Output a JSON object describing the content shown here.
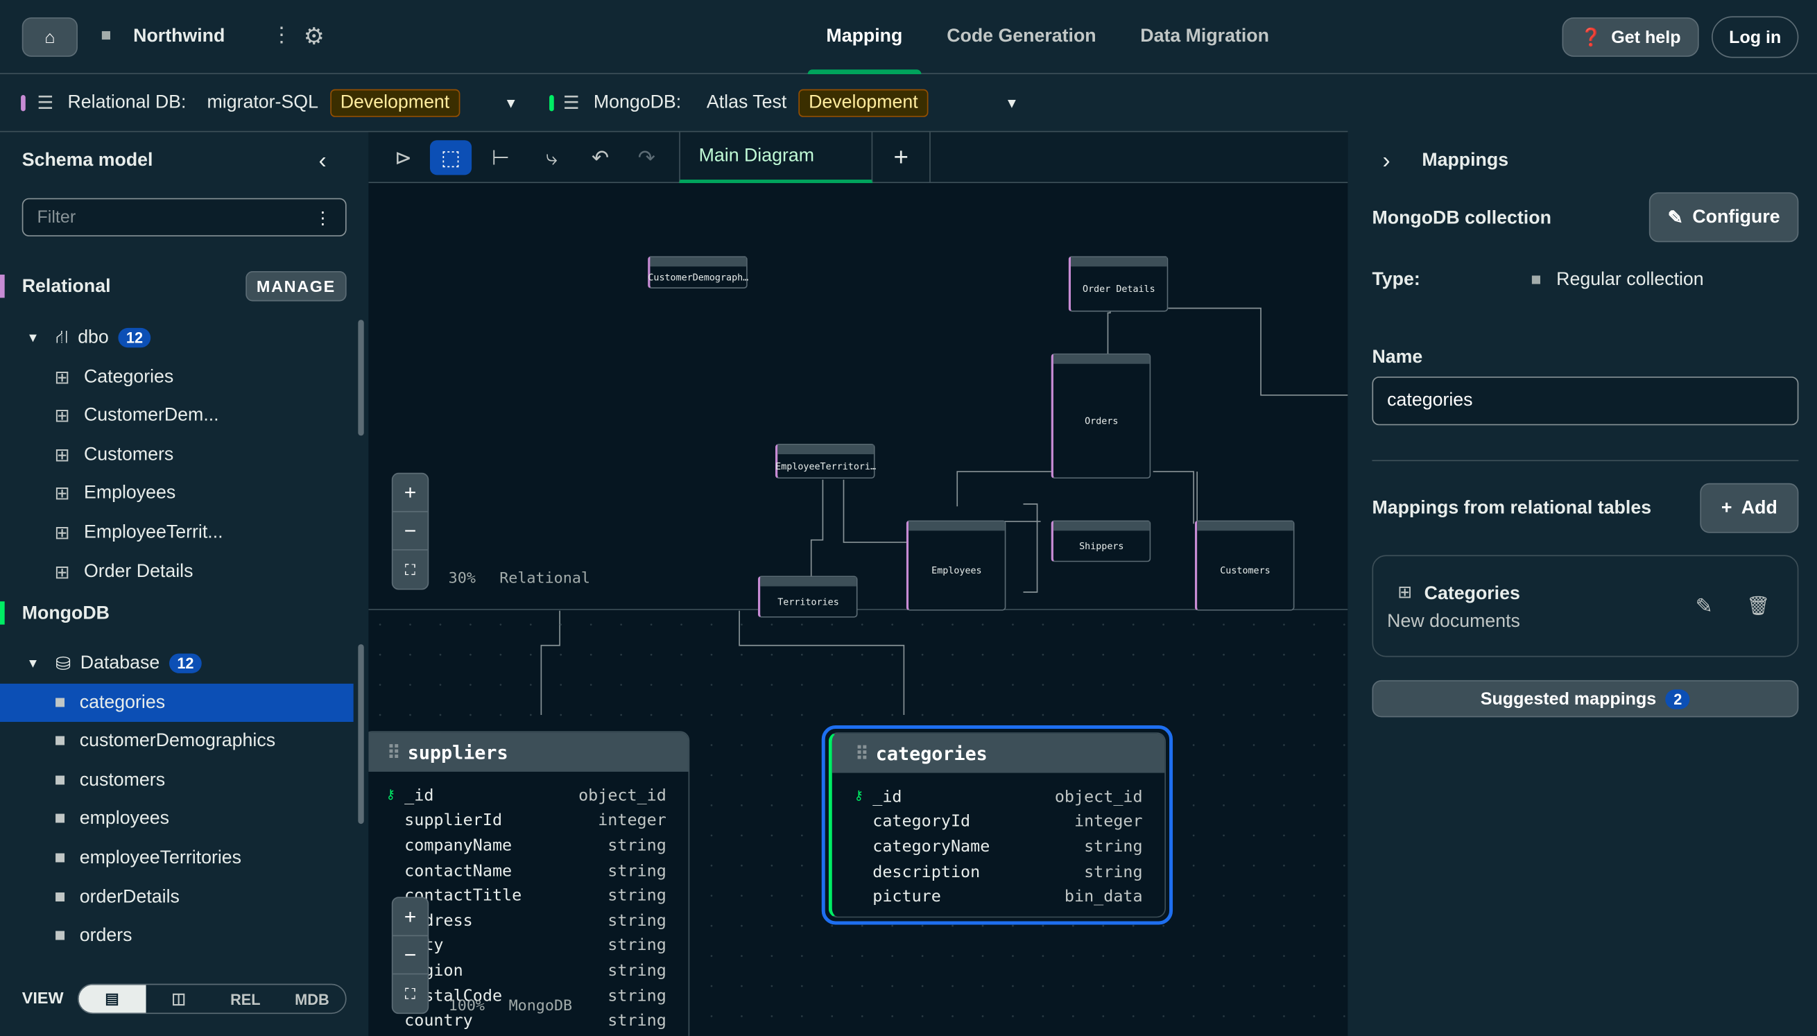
{
  "topbar": {
    "project": "Northwind",
    "tabs": [
      "Mapping",
      "Code Generation",
      "Data Migration"
    ],
    "help": "Get help",
    "login": "Log in"
  },
  "connections": {
    "relational_label": "Relational DB:",
    "relational_name": "migrator-SQL",
    "relational_env": "Development",
    "mongo_label": "MongoDB:",
    "mongo_name": "Atlas Test",
    "mongo_env": "Development"
  },
  "sidebar": {
    "title": "Schema model",
    "filter_placeholder": "Filter",
    "relational": "Relational",
    "manage": "MANAGE",
    "schema": "dbo",
    "schema_count": "12",
    "tables": [
      "Categories",
      "CustomerDem...",
      "Customers",
      "Employees",
      "EmployeeTerrit...",
      "Order Details"
    ],
    "mongodb": "MongoDB",
    "database": "Database",
    "database_count": "12",
    "collections": [
      "categories",
      "customerDemographics",
      "customers",
      "employees",
      "employeeTerritories",
      "orderDetails",
      "orders"
    ],
    "view_label": "VIEW",
    "view_options": [
      "REL",
      "MDB"
    ]
  },
  "canvas": {
    "diagram_tab": "Main Diagram",
    "relational_zoom": "30%",
    "relational_label": "Relational",
    "mongo_zoom": "100%",
    "mongo_label": "MongoDB",
    "relational_tables": [
      "CustomerDemograph…",
      "Order Details",
      "Orders",
      "EmployeeTerritori…",
      "Shippers",
      "Employees",
      "Territories",
      "Customers"
    ],
    "suppliers": {
      "name": "suppliers",
      "fields": [
        [
          "_id",
          "object_id"
        ],
        [
          "supplierId",
          "integer"
        ],
        [
          "companyName",
          "string"
        ],
        [
          "contactName",
          "string"
        ],
        [
          "contactTitle",
          "string"
        ],
        [
          "address",
          "string"
        ],
        [
          "city",
          "string"
        ],
        [
          "region",
          "string"
        ],
        [
          "postalCode",
          "string"
        ],
        [
          "country",
          "string"
        ]
      ]
    },
    "categories": {
      "name": "categories",
      "fields": [
        [
          "_id",
          "object_id"
        ],
        [
          "categoryId",
          "integer"
        ],
        [
          "categoryName",
          "string"
        ],
        [
          "description",
          "string"
        ],
        [
          "picture",
          "bin_data"
        ]
      ]
    }
  },
  "panel": {
    "title": "Mappings",
    "collection_label": "MongoDB collection",
    "configure": "Configure",
    "type_label": "Type:",
    "type_value": "Regular collection",
    "name_label": "Name",
    "name_value": "categories",
    "mappings_label": "Mappings from relational tables",
    "add": "Add",
    "mapping_table": "Categories",
    "mapping_desc": "New documents",
    "suggested": "Suggested mappings",
    "suggested_count": "2"
  },
  "colors": {
    "accent": "#0c4fb5",
    "green": "#00a35c",
    "relational": "#c78bd4"
  }
}
